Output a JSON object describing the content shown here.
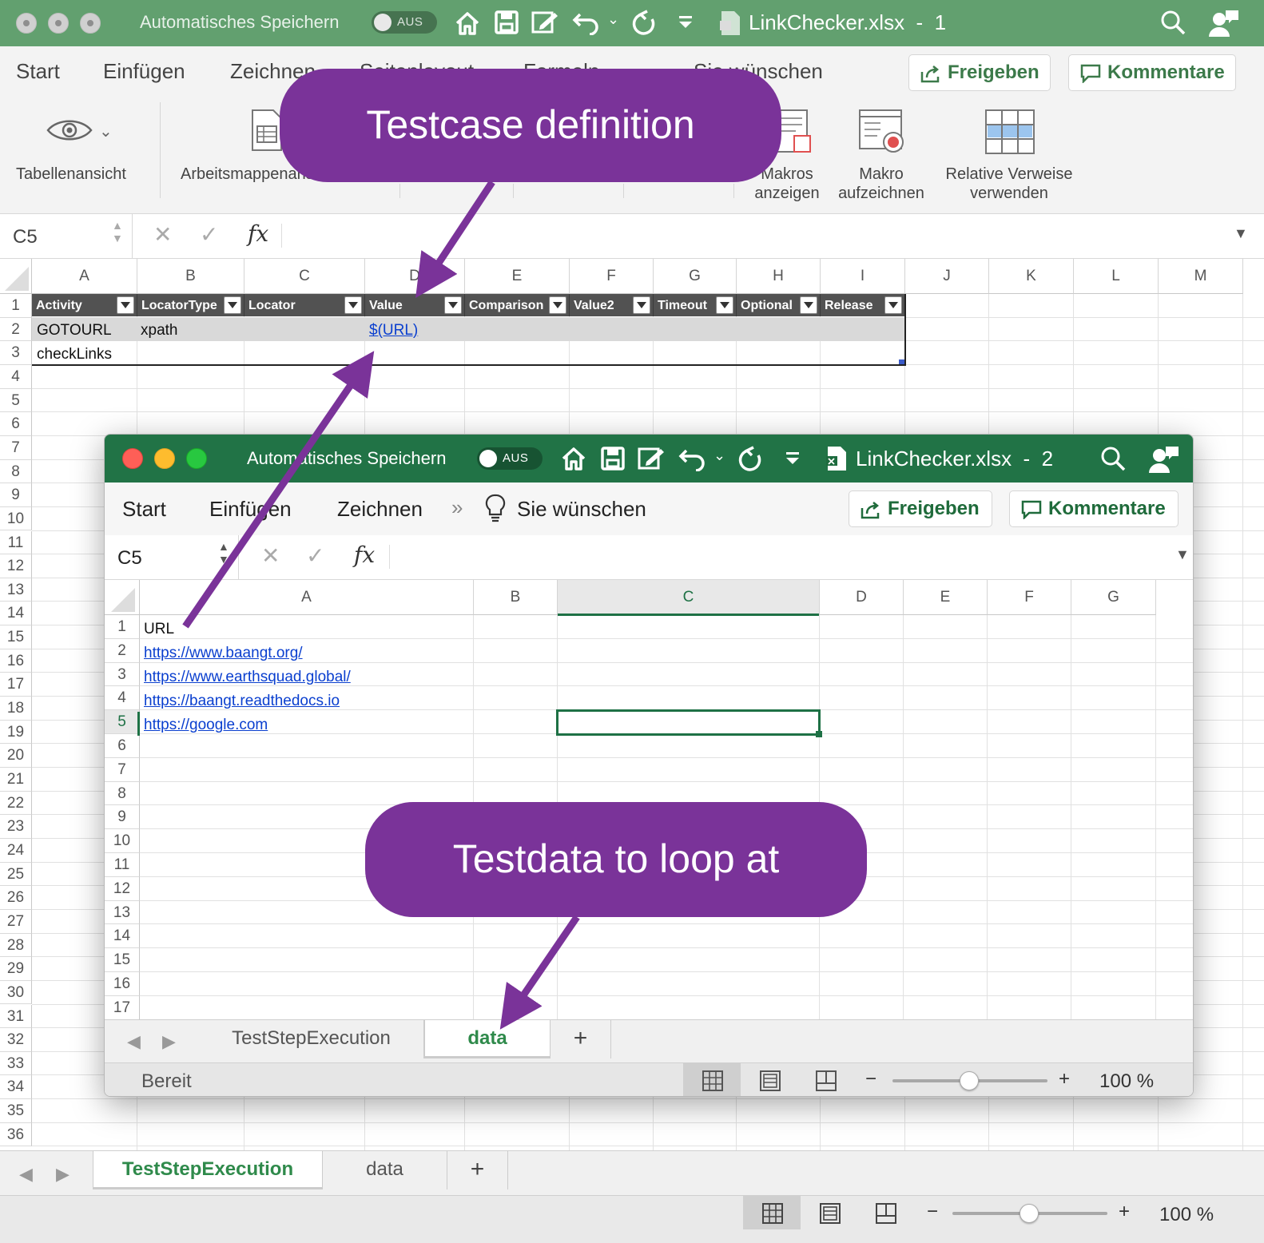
{
  "win1": {
    "autosave_label": "Automatisches Speichern",
    "autosave_state": "AUS",
    "filename": "LinkChecker.xlsx",
    "separator": "-",
    "window_index": "1",
    "tabs": [
      "Start",
      "Einfügen",
      "Zeichnen",
      "Seitenlayout",
      "Formeln",
      "Sie wünschen"
    ],
    "share_label": "Freigeben",
    "comments_label": "Kommentare",
    "ribbon": {
      "view_label": "Tabellenansicht",
      "workbook_label": "Arbeitsmappenansichten",
      "macros_label_1": "Makros",
      "macros_label_2": "anzeigen",
      "record_label_1": "Makro",
      "record_label_2": "aufzeichnen",
      "relative_label_1": "Relative Verweise",
      "relative_label_2": "verwenden"
    },
    "cell_ref": "C5",
    "fx": "fx",
    "columns": [
      "A",
      "B",
      "C",
      "D",
      "E",
      "F",
      "G",
      "H",
      "I",
      "J",
      "K",
      "L",
      "M"
    ],
    "table_headers": [
      "Activity",
      "LocatorType",
      "Locator",
      "Value",
      "Comparison",
      "Value2",
      "Timeout",
      "Optional",
      "Release"
    ],
    "rows": [
      {
        "activity": "GOTOURL",
        "locator_type": "xpath",
        "value": "$(URL)"
      },
      {
        "activity": "checkLinks"
      }
    ],
    "sheet_tabs": [
      "TestStepExecution",
      "data"
    ],
    "add_sheet": "+",
    "zoom_minus": "−",
    "zoom_plus": "+",
    "zoom": "100 %"
  },
  "win2": {
    "autosave_label": "Automatisches Speichern",
    "autosave_state": "AUS",
    "filename": "LinkChecker.xlsx",
    "separator": "-",
    "window_index": "2",
    "tabs": [
      "Start",
      "Einfügen",
      "Zeichnen",
      "Sie wünschen"
    ],
    "more_tabs": "»",
    "share_label": "Freigeben",
    "comments_label": "Kommentare",
    "cell_ref": "C5",
    "fx": "fx",
    "columns": [
      "A",
      "B",
      "C",
      "D",
      "E",
      "F",
      "G"
    ],
    "cells": [
      "URL",
      "https://www.baangt.org/",
      "https://www.earthsquad.global/",
      "https://baangt.readthedocs.io",
      "https://google.com"
    ],
    "sheet_tabs": [
      "TestStepExecution",
      "data"
    ],
    "add_sheet": "+",
    "status": "Bereit",
    "zoom_minus": "−",
    "zoom_plus": "+",
    "zoom": "100 %"
  },
  "callouts": {
    "definition": "Testcase definition",
    "data": "Testdata to loop at"
  },
  "colors": {
    "title_green_1": "#62a06f",
    "title_green_2": "#217346",
    "callout_purple": "#7a3399",
    "link_blue": "#0a3fcf"
  },
  "icons": [
    "home-icon",
    "save-icon",
    "edit-icon",
    "undo-icon",
    "redo-icon",
    "customize-icon",
    "excel-file-icon",
    "search-icon",
    "share-person-icon",
    "share-icon",
    "comment-icon",
    "eye-icon",
    "lightbulb-icon"
  ]
}
